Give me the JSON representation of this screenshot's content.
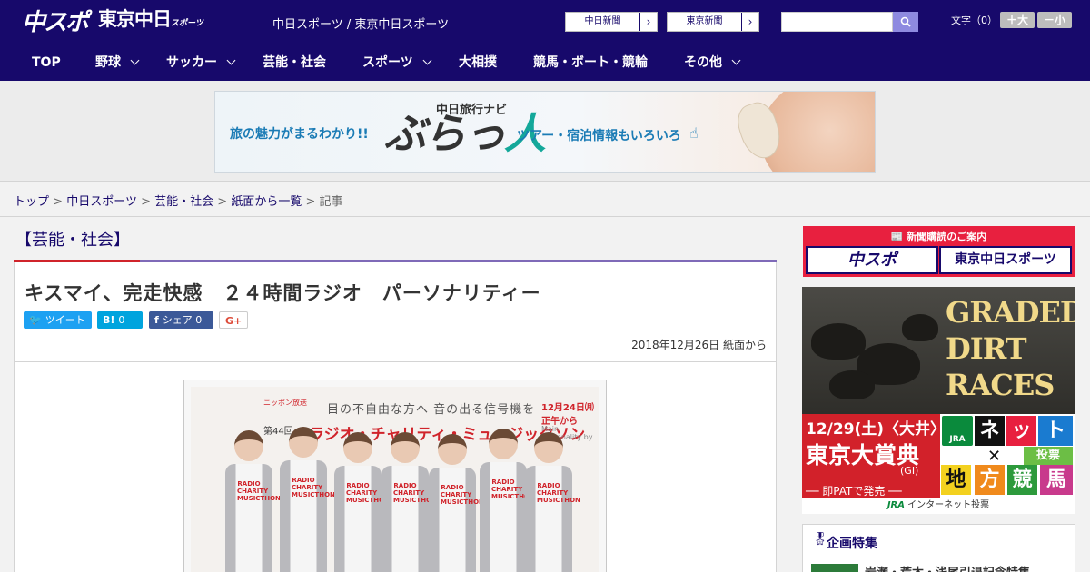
{
  "header": {
    "logo_chu": "中スポ",
    "logo_tokyo": "東京中日",
    "logo_tokyo_small": "スポーツ",
    "site_name": "中日スポーツ / 東京中日スポーツ",
    "links": [
      {
        "label": "中日新聞"
      },
      {
        "label": "東京新聞"
      }
    ],
    "search": {
      "value": "",
      "placeholder": ""
    },
    "font_size_label": "文字（0）",
    "font_larger": "＋大",
    "font_smaller": "－小"
  },
  "nav": {
    "items": [
      {
        "label": "TOP",
        "has_dropdown": false
      },
      {
        "label": "野球",
        "has_dropdown": true
      },
      {
        "label": "サッカー",
        "has_dropdown": true
      },
      {
        "label": "芸能・社会",
        "has_dropdown": false
      },
      {
        "label": "スポーツ",
        "has_dropdown": true
      },
      {
        "label": "大相撲",
        "has_dropdown": false
      },
      {
        "label": "競馬・ボート・競輪",
        "has_dropdown": false
      },
      {
        "label": "その他",
        "has_dropdown": true
      }
    ]
  },
  "banner": {
    "left_text": "旅の魅力がまるわかり!!",
    "small_text": "中日旅行ナビ",
    "big_text_1": "ぶらっ",
    "big_text_2": "人",
    "right_text": "ツアー・宿泊情報もいろいろ"
  },
  "breadcrumb": {
    "items": [
      "トップ",
      "中日スポーツ",
      "芸能・社会",
      "紙面から一覧"
    ],
    "current": "記事",
    "separator": ">"
  },
  "article": {
    "category": "【芸能・社会】",
    "headline": "キスマイ、完走快感　２４時間ラジオ　パーソナリティー",
    "share": {
      "tweet": "ツイート",
      "hatena_icon": "B!",
      "hatena_count": "0",
      "facebook_label": "シェア",
      "facebook_count": "0",
      "google_icon": "G+"
    },
    "date": "2018年12月26日 紙面から",
    "photo": {
      "backdrop_logo": "ニッポン放送",
      "backdrop_text": "目の不自由な方へ 音の出る信号機を",
      "backdrop_no": "第44回",
      "backdrop_title": "ラジオ・チャリティ・ミュージックソン",
      "backdrop_date": "12月24日㈪正午から",
      "backdrop_mp": "Main Personality by K",
      "shirt_text": "RADIO CHARITY MUSICTHON"
    }
  },
  "sidebar": {
    "subscribe": {
      "title": "新聞購読のご案内",
      "option_1": "中スポ",
      "option_2": "東京中日スポーツ"
    },
    "race_ad": {
      "title_lines": [
        "GRADED",
        "DIRT",
        "RACES"
      ],
      "date": "12/29(土)〈大井〉",
      "race_name": "東京大賞典",
      "grade": "(GI)",
      "pat": "── 即PATで発売 ──",
      "jra": "JRA",
      "tiles": [
        "ネ",
        "ッ",
        "ト",
        "投",
        "票",
        "地",
        "方",
        "競",
        "馬"
      ],
      "footer_jra": "JRA",
      "footer_text": "インターネット投票"
    },
    "feature": {
      "title": "企画特集",
      "item": "岩瀬・荒木・浅尾引退記念特集"
    }
  },
  "colors": {
    "brand": "#17096b",
    "accent_red": "#d0242b",
    "twitter": "#1da1f2",
    "hatena": "#00a4de",
    "facebook": "#3b5998"
  }
}
